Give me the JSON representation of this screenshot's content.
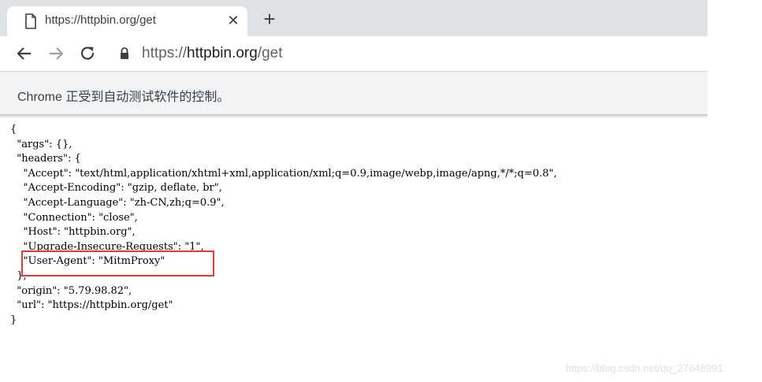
{
  "tab": {
    "title": "https://httpbin.org/get",
    "close_glyph": "✕",
    "new_tab_glyph": "+"
  },
  "address_bar": {
    "scheme": "https://",
    "host": "httpbin.org",
    "path": "/get"
  },
  "infobar": {
    "text": "Chrome 正受到自动测试软件的控制。"
  },
  "json_lines": [
    "{",
    "  \"args\": {},",
    "  \"headers\": {",
    "    \"Accept\": \"text/html,application/xhtml+xml,application/xml;q=0.9,image/webp,image/apng,*/*;q=0.8\",",
    "    \"Accept-Encoding\": \"gzip, deflate, br\",",
    "    \"Accept-Language\": \"zh-CN,zh;q=0.9\",",
    "    \"Connection\": \"close\",",
    "    \"Host\": \"httpbin.org\",",
    "    \"Upgrade-Insecure-Requests\": \"1\",",
    "    \"User-Agent\": \"MitmProxy\"",
    "  },",
    "  \"origin\": \"5.79.98.82\",",
    "  \"url\": \"https://httpbin.org/get\"",
    "}"
  ],
  "watermark": "https://blog.csdn.net/qq_27648991",
  "colors": {
    "tabstrip": "#dee1e6",
    "infobar": "#f1f3f4",
    "highlight": "#e53935"
  },
  "icons": {
    "tab_page": "page-icon",
    "back": "arrow-left-icon",
    "forward": "arrow-right-icon",
    "reload": "reload-icon",
    "lock": "lock-icon"
  }
}
